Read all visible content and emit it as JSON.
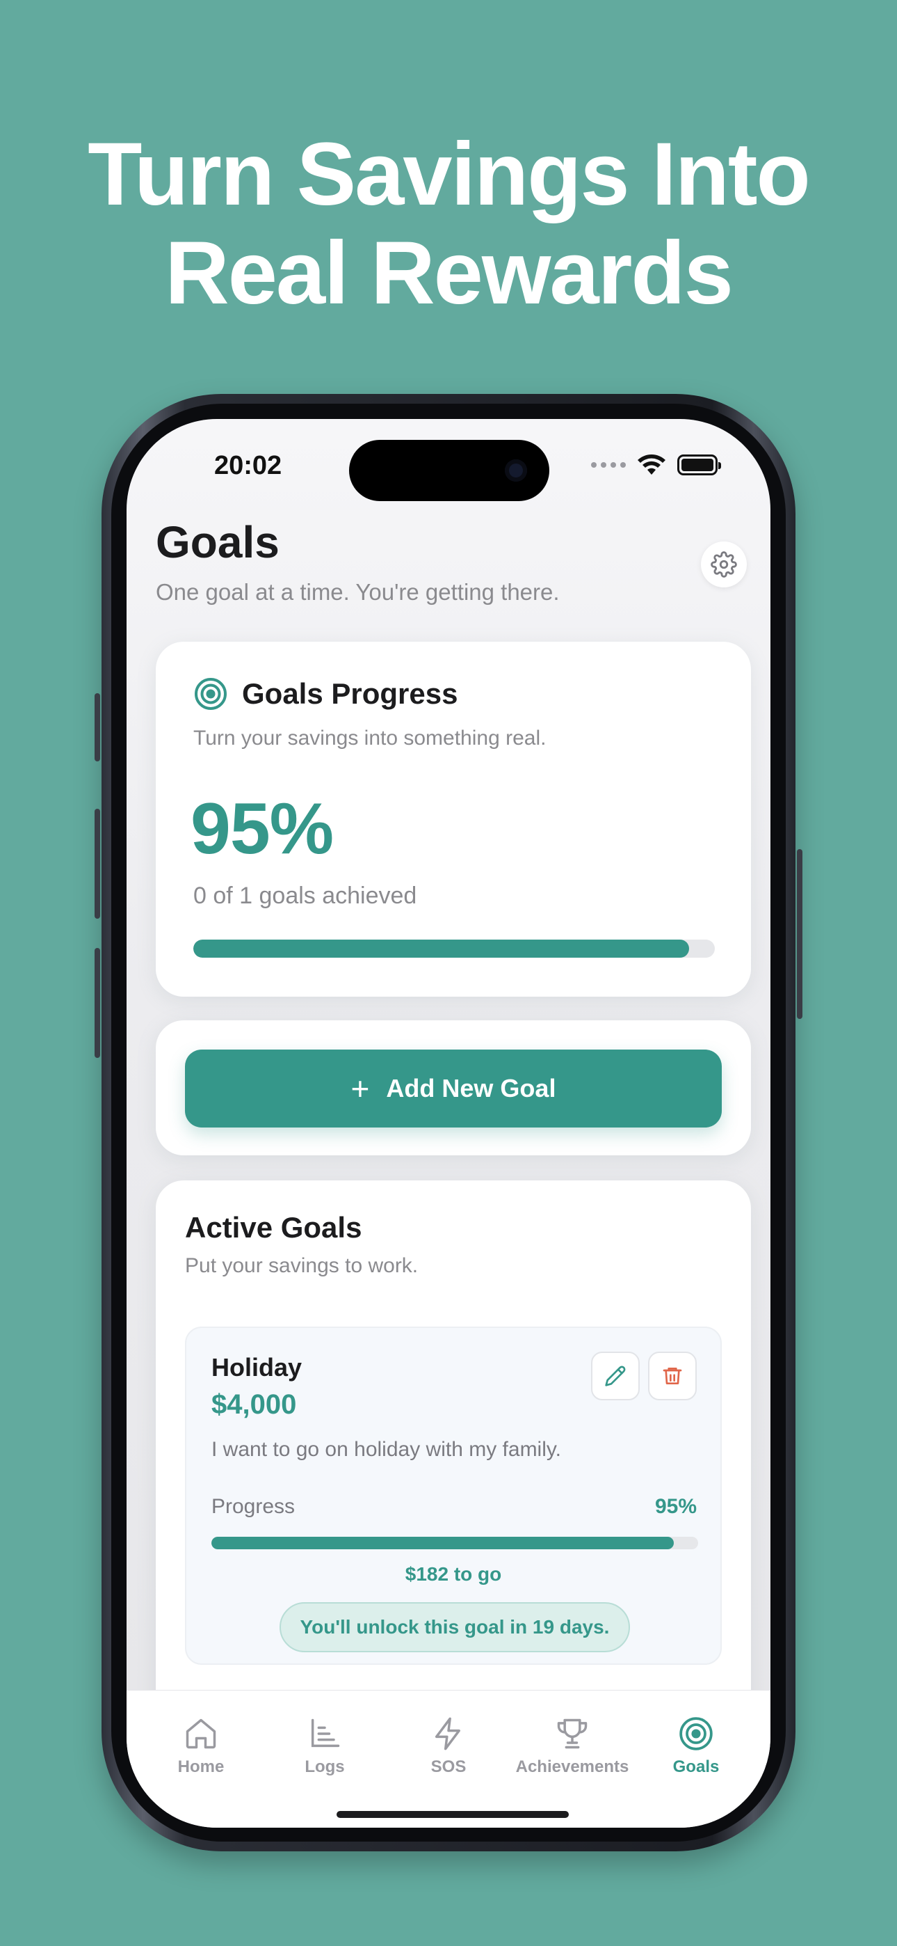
{
  "headline": {
    "line1": "Turn Savings Into",
    "line2": "Real Rewards"
  },
  "colors": {
    "background": "#62aa9e",
    "accent": "#35978a",
    "danger": "#e0664a"
  },
  "status_bar": {
    "time": "20:02",
    "icons": [
      "wifi-icon",
      "battery-icon"
    ]
  },
  "header": {
    "title": "Goals",
    "subtitle": "One goal at a time. You're getting there.",
    "settings_icon": "gear-icon"
  },
  "progress_card": {
    "icon": "target-icon",
    "title": "Goals Progress",
    "subtitle": "Turn your savings into something real.",
    "percent_label": "95%",
    "progress": 0.95,
    "achieved_text": "0 of 1 goals achieved"
  },
  "add_goal": {
    "label": "Add New Goal",
    "icon": "plus-icon"
  },
  "active_goals": {
    "title": "Active Goals",
    "subtitle": "Put your savings to work.",
    "items": [
      {
        "name": "Holiday",
        "amount": "$4,000",
        "description": "I want to go on holiday with my family.",
        "progress_label": "Progress",
        "progress_value": "95%",
        "progress": 0.95,
        "to_go": "$182 to go",
        "unlock_text": "You'll unlock this goal in 19 days."
      }
    ]
  },
  "tabbar": {
    "tabs": [
      {
        "label": "Home",
        "icon": "home-icon",
        "active": false
      },
      {
        "label": "Logs",
        "icon": "chart-icon",
        "active": false
      },
      {
        "label": "SOS",
        "icon": "lightning-icon",
        "active": false
      },
      {
        "label": "Achievements",
        "icon": "trophy-icon",
        "active": false
      },
      {
        "label": "Goals",
        "icon": "target-icon",
        "active": true
      }
    ]
  }
}
